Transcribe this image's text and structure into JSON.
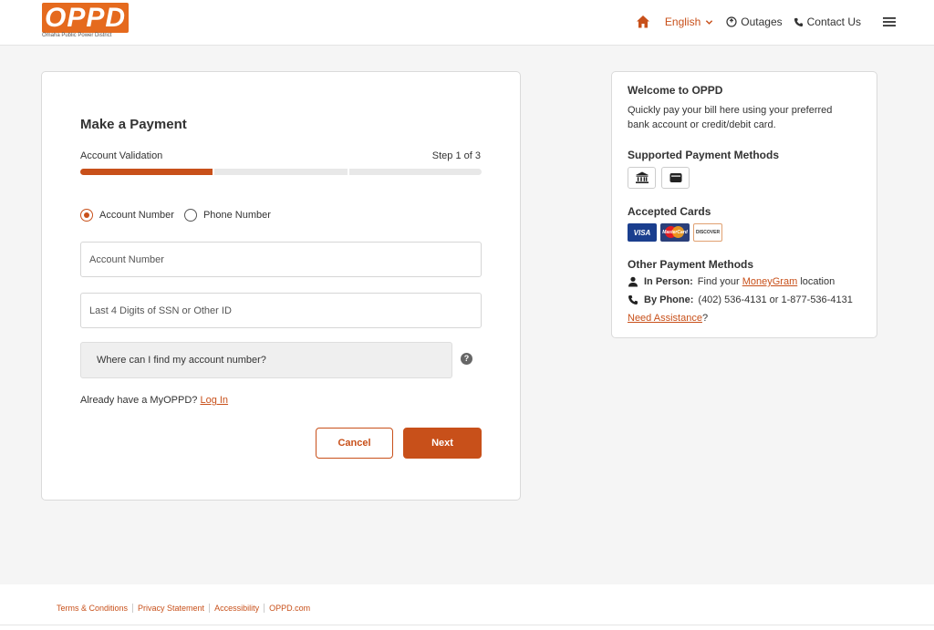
{
  "brand": {
    "logo_text": "OPPD",
    "logo_subtitle": "Omaha Public Power District",
    "accent_color": "#c8501a"
  },
  "nav": {
    "home_icon": "home-icon",
    "language": "English",
    "outages": "Outages",
    "contact": "Contact Us",
    "menu_icon": "hamburger-menu-icon"
  },
  "payment_form": {
    "title": "Make a Payment",
    "step_label": "Account Validation",
    "step_count": "Step 1 of 3",
    "progress": {
      "current_step": 1,
      "total_steps": 3
    },
    "radio_options": [
      {
        "label": "Account Number",
        "selected": true
      },
      {
        "label": "Phone Number",
        "selected": false
      }
    ],
    "account_number_placeholder": "Account Number",
    "ssn_placeholder": "Last 4 Digits of SSN or Other ID",
    "helper_text": "Where can I find my account number?",
    "help_icon_glyph": "?",
    "login_prompt": "Already have a MyOPPD?",
    "login_link": "Log In",
    "cancel_label": "Cancel",
    "next_label": "Next"
  },
  "info_panel": {
    "welcome_title": "Welcome to OPPD",
    "welcome_text": "Quickly pay your bill here using your preferred bank account or credit/debit card.",
    "supported_title": "Supported Payment Methods",
    "supported_methods": [
      "bank-icon",
      "wallet-icon"
    ],
    "accepted_title": "Accepted Cards",
    "cards": [
      {
        "name": "visa-card-icon",
        "text": "VISA"
      },
      {
        "name": "mastercard-card-icon",
        "text": "MasterCard"
      },
      {
        "name": "discover-card-icon",
        "text": "DISCOVER"
      }
    ],
    "other_title": "Other Payment Methods",
    "in_person_label": "In Person:",
    "in_person_text_before": "Find your",
    "in_person_link": "MoneyGram",
    "in_person_text_after": "location",
    "by_phone_label": "By Phone:",
    "by_phone_text": "(402) 536-4131 or 1-877-536-4131",
    "assistance_link": "Need Assistance",
    "assistance_suffix": "?"
  },
  "footer": {
    "links": [
      "Terms & Conditions",
      "Privacy Statement",
      "Accessibility",
      "OPPD.com"
    ]
  }
}
